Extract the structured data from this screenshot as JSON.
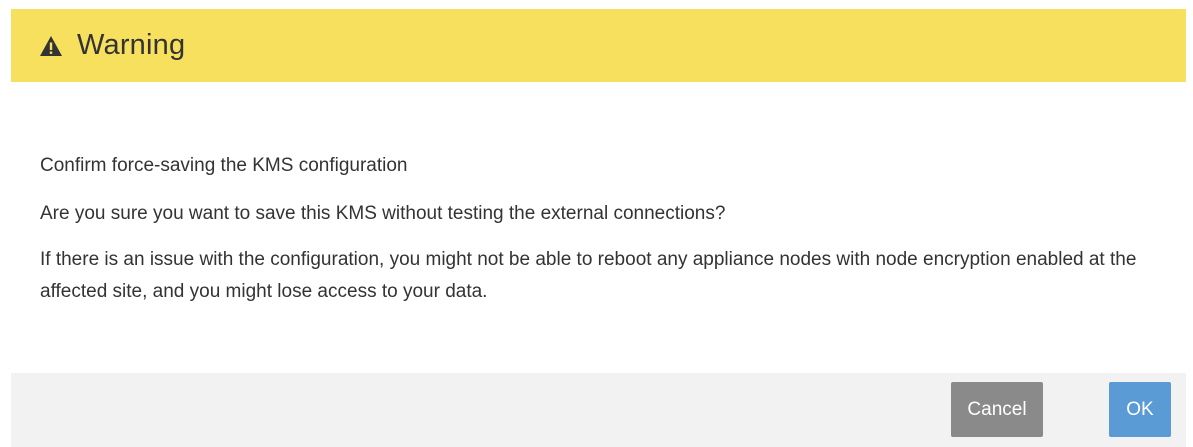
{
  "dialog": {
    "title": "Warning",
    "icon": "warning-triangle-icon",
    "header_color": "#f7e05e",
    "body": {
      "heading": "Confirm force-saving the KMS configuration",
      "question": "Are you sure you want to save this KMS without testing the external connections?",
      "detail": "If there is an issue with the configuration, you might not be able to reboot any appliance nodes with node encryption enabled at the affected site, and you might lose access to your data."
    },
    "buttons": {
      "cancel_label": "Cancel",
      "ok_label": "OK",
      "cancel_color": "#8a8a8a",
      "ok_color": "#5b9bd5"
    }
  }
}
